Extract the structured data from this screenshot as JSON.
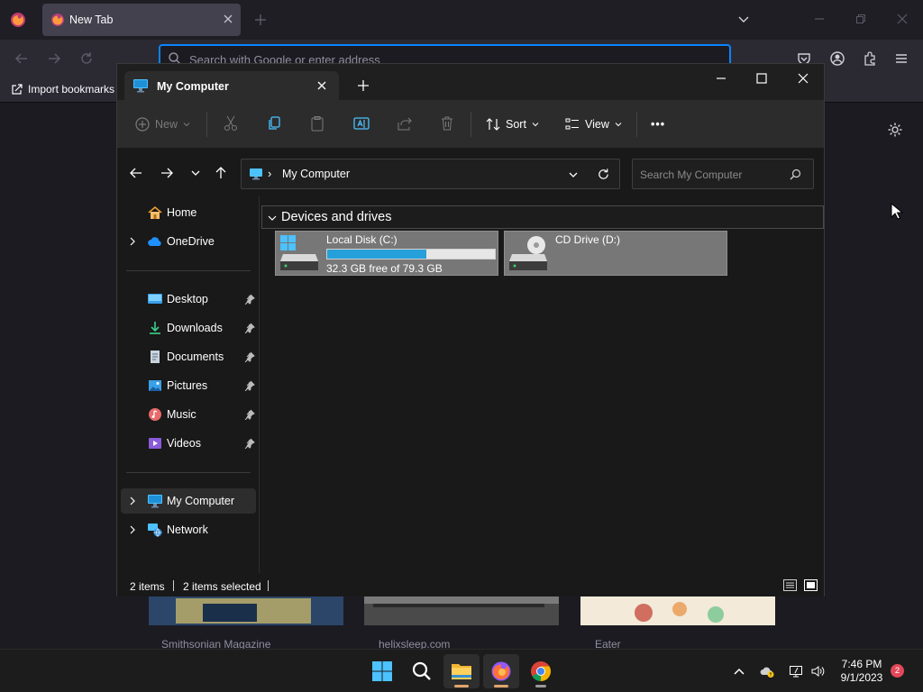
{
  "firefox": {
    "tab_title": "New Tab",
    "search_placeholder": "Search with Google or enter address",
    "import_bookmarks": "Import bookmarks",
    "tiles": [
      "Smithsonian Magazine",
      "helixsleep.com",
      "Eater"
    ]
  },
  "explorer": {
    "tab_title": "My Computer",
    "command_bar": {
      "new_label": "New",
      "sort_label": "Sort",
      "view_label": "View",
      "more_label": "•••"
    },
    "address": {
      "separator": "›",
      "path": "My Computer",
      "search_placeholder": "Search My Computer"
    },
    "sidebar": {
      "top": [
        {
          "label": "Home",
          "icon": "home-icon"
        },
        {
          "label": "OneDrive",
          "icon": "cloud-icon"
        }
      ],
      "quick_access": [
        {
          "label": "Desktop",
          "icon": "desktop-icon"
        },
        {
          "label": "Downloads",
          "icon": "download-icon"
        },
        {
          "label": "Documents",
          "icon": "document-icon"
        },
        {
          "label": "Pictures",
          "icon": "pictures-icon"
        },
        {
          "label": "Music",
          "icon": "music-icon"
        },
        {
          "label": "Videos",
          "icon": "videos-icon"
        }
      ],
      "bottom": [
        {
          "label": "My Computer",
          "icon": "computer-icon",
          "selected": true
        },
        {
          "label": "Network",
          "icon": "network-icon"
        }
      ]
    },
    "group_header": "Devices and drives",
    "drives": [
      {
        "name": "Local Disk (C:)",
        "free_text": "32.3 GB free of 79.3 GB",
        "used_fraction": 0.593
      },
      {
        "name": "CD Drive (D:)"
      }
    ],
    "status": {
      "items": "2 items",
      "selected": "2 items selected"
    }
  },
  "taskbar": {
    "time": "7:46 PM",
    "date": "9/1/2023",
    "notification_count": "2"
  },
  "colors": {
    "accent": "#0a84ff",
    "drive_bar": "#26a0da",
    "notification": "#e3485a"
  }
}
